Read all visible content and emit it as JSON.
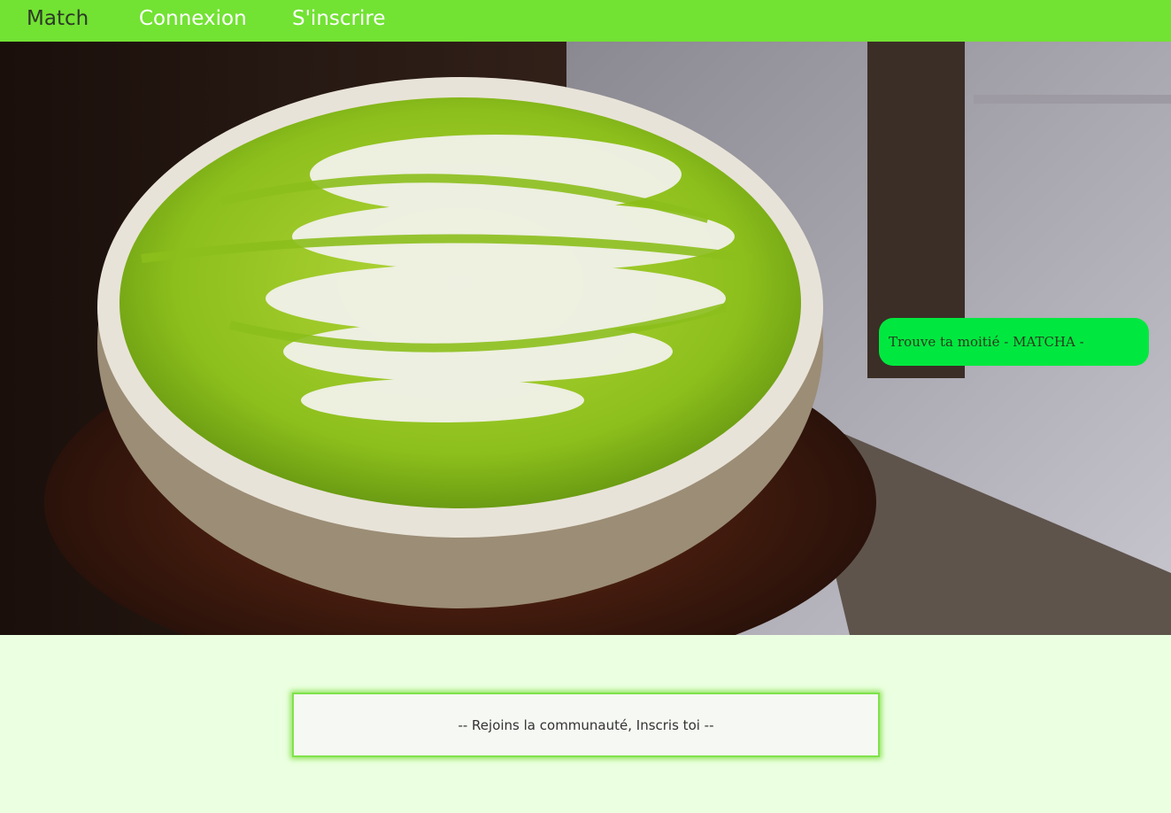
{
  "nav": {
    "brand": "Match",
    "login": "Connexion",
    "signup": "S'inscrire"
  },
  "hero": {
    "image_subject": "matcha-latte-cup",
    "tagline": "Trouve ta moitié - MATCHA -"
  },
  "cta": {
    "label": "-- Rejoins la communauté, Inscris toi --"
  },
  "colors": {
    "navbar": "#72e233",
    "page_background": "#ebffe1",
    "tagline_background": "#00e83f",
    "cta_border": "#80e24b"
  }
}
